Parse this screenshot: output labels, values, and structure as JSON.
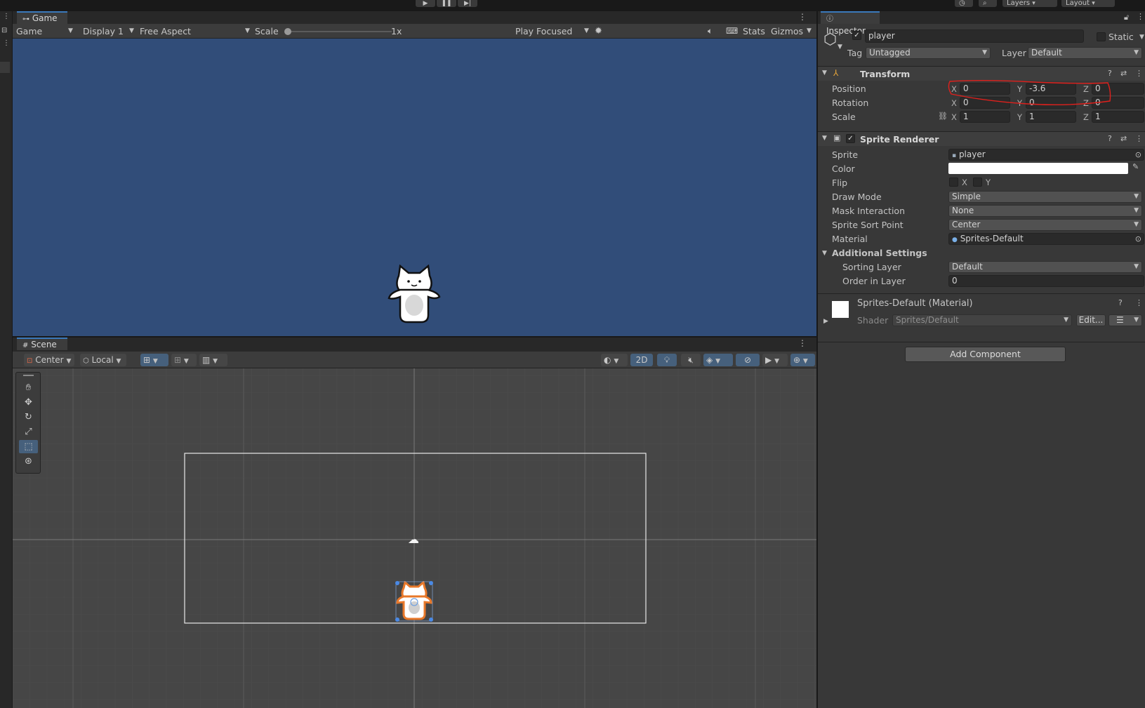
{
  "topbar": {
    "play_icon": "play-icon",
    "pause_icon": "pause-icon",
    "step_icon": "step-icon",
    "layers_label": "Layers",
    "layout_label": "Layout"
  },
  "game": {
    "tab_label": "Game",
    "view_dropdown": "Game",
    "display_dropdown": "Display 1",
    "aspect_dropdown": "Free Aspect",
    "scale_label": "Scale",
    "scale_value": "1x",
    "play_mode_dropdown": "Play Focused",
    "stats_label": "Stats",
    "gizmos_label": "Gizmos",
    "background_color": "#314d79"
  },
  "scene": {
    "tab_label": "Scene",
    "pivot_dropdown": "Center",
    "space_dropdown": "Local",
    "mode_2d_label": "2D"
  },
  "inspector": {
    "tab_label": "Inspector",
    "object_name": "player",
    "static_label": "Static",
    "tag_label": "Tag",
    "tag_value": "Untagged",
    "layer_label": "Layer",
    "layer_value": "Default",
    "transform": {
      "title": "Transform",
      "position_label": "Position",
      "rotation_label": "Rotation",
      "scale_label": "Scale",
      "position": {
        "x": "0",
        "y": "-3.6",
        "z": "0"
      },
      "rotation": {
        "x": "0",
        "y": "0",
        "z": "0"
      },
      "scale": {
        "x": "1",
        "y": "1",
        "z": "1"
      },
      "axis_x": "X",
      "axis_y": "Y",
      "axis_z": "Z"
    },
    "sprite_renderer": {
      "title": "Sprite Renderer",
      "sprite_label": "Sprite",
      "sprite_value": "player",
      "color_label": "Color",
      "color_value": "#ffffff",
      "flip_label": "Flip",
      "flip_x": "X",
      "flip_y": "Y",
      "draw_mode_label": "Draw Mode",
      "draw_mode_value": "Simple",
      "mask_label": "Mask Interaction",
      "mask_value": "None",
      "sort_point_label": "Sprite Sort Point",
      "sort_point_value": "Center",
      "material_label": "Material",
      "material_value": "Sprites-Default",
      "additional_label": "Additional Settings",
      "sorting_layer_label": "Sorting Layer",
      "sorting_layer_value": "Default",
      "order_label": "Order in Layer",
      "order_value": "0"
    },
    "material": {
      "title": "Sprites-Default (Material)",
      "shader_label": "Shader",
      "shader_value": "Sprites/Default",
      "edit_label": "Edit..."
    },
    "add_component_label": "Add Component"
  },
  "annotation_color": "#e0201c"
}
